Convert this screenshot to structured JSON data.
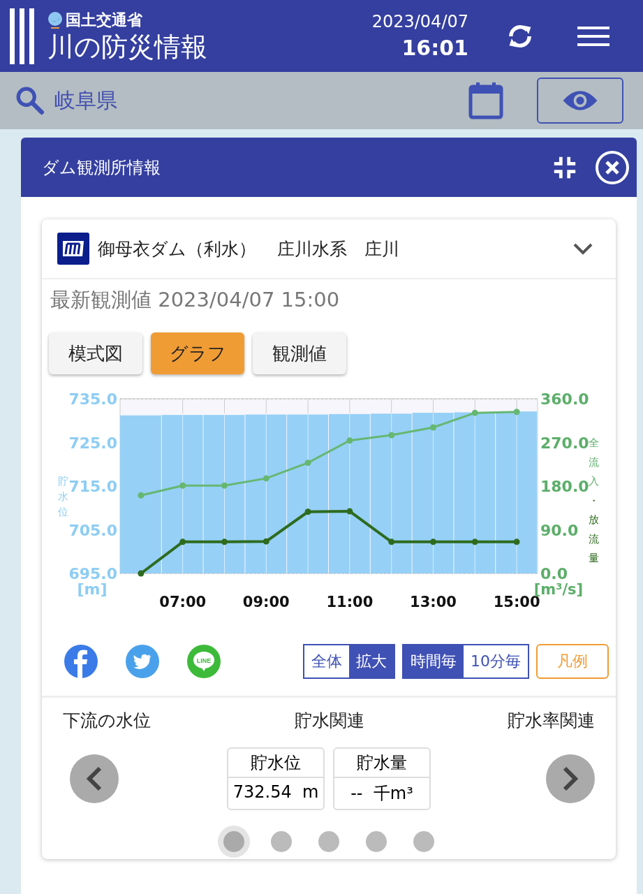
{
  "header": {
    "ministry": "国土交通省",
    "title": "川の防災情報",
    "date": "2023/04/07",
    "time": "16:01"
  },
  "search": {
    "value": "岐阜県"
  },
  "panel": {
    "title": "ダム観測所情報"
  },
  "station": {
    "name": "御母衣ダム（利水）",
    "river": "庄川水系　庄川",
    "expanded": false
  },
  "latest": "最新観測値 2023/04/07 15:00",
  "view_tabs": [
    {
      "label": "模式図",
      "selected": false
    },
    {
      "label": "グラフ",
      "selected": true
    },
    {
      "label": "観測値",
      "selected": false
    }
  ],
  "chart": {
    "y_unit": "[m]",
    "y2_unit": "[m³/s]",
    "y2label_parts": [
      {
        "text": "全流入",
        "color": "#5cae6a"
      },
      {
        "text": "・放流量",
        "color": "#2e6b1f"
      }
    ],
    "chart_data": {
      "type": "bar",
      "ylabel": "貯水位",
      "grid": true,
      "x": [
        6,
        7,
        8,
        9,
        10,
        11,
        12,
        13,
        14,
        15
      ],
      "xlim": [
        5.5,
        15.5
      ],
      "ylim": [
        695,
        735
      ],
      "yticks": [
        {
          "value": 695,
          "label": "695.0"
        },
        {
          "value": 705,
          "label": "705.0"
        },
        {
          "value": 715,
          "label": "715.0"
        },
        {
          "value": 725,
          "label": "725.0"
        },
        {
          "value": 735,
          "label": "735.0"
        }
      ],
      "y2lim": [
        0,
        360
      ],
      "y2ticks": [
        {
          "value": 0,
          "label": "0.0"
        },
        {
          "value": 90,
          "label": "90.0"
        },
        {
          "value": 180,
          "label": "180.0"
        },
        {
          "value": 270,
          "label": "270.0"
        },
        {
          "value": 360,
          "label": "360.0"
        }
      ],
      "xticks": [
        {
          "value": 7,
          "label": "07:00"
        },
        {
          "value": 9,
          "label": "09:00"
        },
        {
          "value": 11,
          "label": "11:00"
        },
        {
          "value": 13,
          "label": "13:00"
        },
        {
          "value": 15,
          "label": "15:00"
        }
      ],
      "series": [
        {
          "color": "#96d0f7",
          "values": [
            731.2,
            731.3,
            731.3,
            731.4,
            731.4,
            731.5,
            731.6,
            731.8,
            731.9,
            732.1
          ]
        },
        {
          "type": "line",
          "marker": true,
          "axis": "y2",
          "color": "#66b772",
          "values": [
            161,
            181,
            181,
            196,
            228,
            274,
            285,
            301,
            331,
            333
          ]
        },
        {
          "type": "line",
          "marker": true,
          "axis": "y2",
          "color": "#2e6b1f",
          "values": [
            0,
            65,
            65,
            66,
            127,
            128,
            65,
            65,
            65,
            65
          ]
        }
      ]
    }
  },
  "share": [
    {
      "kind": "facebook"
    },
    {
      "kind": "twitter"
    },
    {
      "kind": "line",
      "text": "LINE"
    }
  ],
  "range_toggle": [
    {
      "label": "全体",
      "selected": false
    },
    {
      "label": "拡大",
      "selected": true
    }
  ],
  "interval_toggle": [
    {
      "label": "時間毎",
      "selected": true
    },
    {
      "label": "10分毎",
      "selected": false
    }
  ],
  "legend_button": "凡例",
  "carousel": {
    "prev_label": "下流の水位",
    "title": "貯水関連",
    "next_label": "貯水率関連",
    "items": [
      {
        "label": "貯水位",
        "value": "732.54  m"
      },
      {
        "label": "貯水量",
        "value": "--  千m³"
      }
    ],
    "dots": [
      {
        "selected": true
      },
      {
        "selected": false
      },
      {
        "selected": false
      },
      {
        "selected": false
      },
      {
        "selected": false
      }
    ]
  }
}
